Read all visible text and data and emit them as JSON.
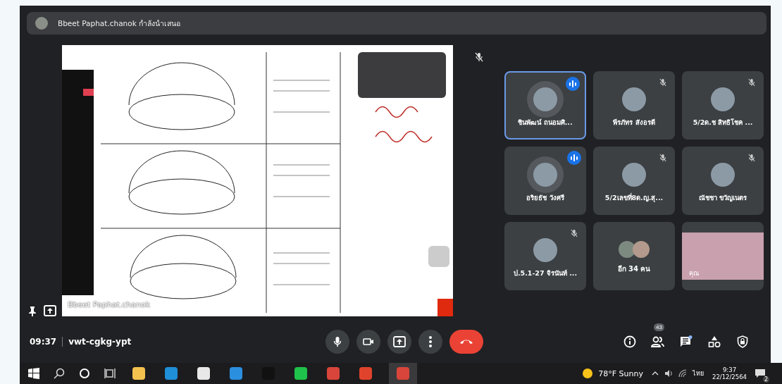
{
  "top_bar": {
    "presenter_text": "Bbeet Paphat.chanok กำลังนำเสนอ"
  },
  "presentation": {
    "presenter_label": "Bbeet Paphat.chanok",
    "presenter_muted": true
  },
  "tiles": [
    {
      "kind": "avatar",
      "name": "ชินพัฒน์ ถนอมศิ...",
      "speaking": true,
      "muted": false,
      "selected": true
    },
    {
      "kind": "avatar",
      "name": "พีรภัทร สังอรดี",
      "speaking": false,
      "muted": true,
      "selected": false
    },
    {
      "kind": "avatar",
      "name": "5/2ด.ช สิทธิโชค ...",
      "speaking": false,
      "muted": true,
      "selected": false
    },
    {
      "kind": "avatar",
      "name": "อริยธัช วังศรี",
      "speaking": true,
      "muted": false,
      "selected": false
    },
    {
      "kind": "avatar",
      "name": "5/2เลขที่8ด.ญ.สุ...",
      "speaking": false,
      "muted": true,
      "selected": false
    },
    {
      "kind": "avatar",
      "name": "ณัชชา ขวัญเนตร",
      "speaking": false,
      "muted": true,
      "selected": false
    },
    {
      "kind": "avatar",
      "name": "ป.5.1-27 จิรนันท์ ...",
      "speaking": false,
      "muted": true,
      "selected": false
    },
    {
      "kind": "more",
      "name": "อีก 34 คน",
      "selected": false
    },
    {
      "kind": "video",
      "name": "คุณ",
      "selected": false
    }
  ],
  "bottom_bar": {
    "time": "09:37",
    "meeting_code": "vwt-cgkg-ypt",
    "controls": [
      {
        "kind": "mic"
      },
      {
        "kind": "camera"
      },
      {
        "kind": "present"
      },
      {
        "kind": "more"
      },
      {
        "kind": "hangup"
      }
    ],
    "side_controls": [
      {
        "kind": "info"
      },
      {
        "kind": "people",
        "badge": "43"
      },
      {
        "kind": "chat"
      },
      {
        "kind": "activities"
      },
      {
        "kind": "security"
      }
    ]
  },
  "taskbar": {
    "apps": [
      {
        "kind": "start"
      },
      {
        "kind": "search"
      },
      {
        "kind": "cortana"
      },
      {
        "kind": "taskview"
      },
      {
        "kind": "explorer"
      },
      {
        "kind": "edge"
      },
      {
        "kind": "store"
      },
      {
        "kind": "mail"
      },
      {
        "kind": "netflix"
      },
      {
        "kind": "line"
      },
      {
        "kind": "chrome"
      },
      {
        "kind": "office"
      },
      {
        "kind": "chrome"
      }
    ],
    "weather": "78°F Sunny",
    "language": "ไทย",
    "time": "9:37",
    "date": "22/12/2564",
    "notifications": "2"
  }
}
